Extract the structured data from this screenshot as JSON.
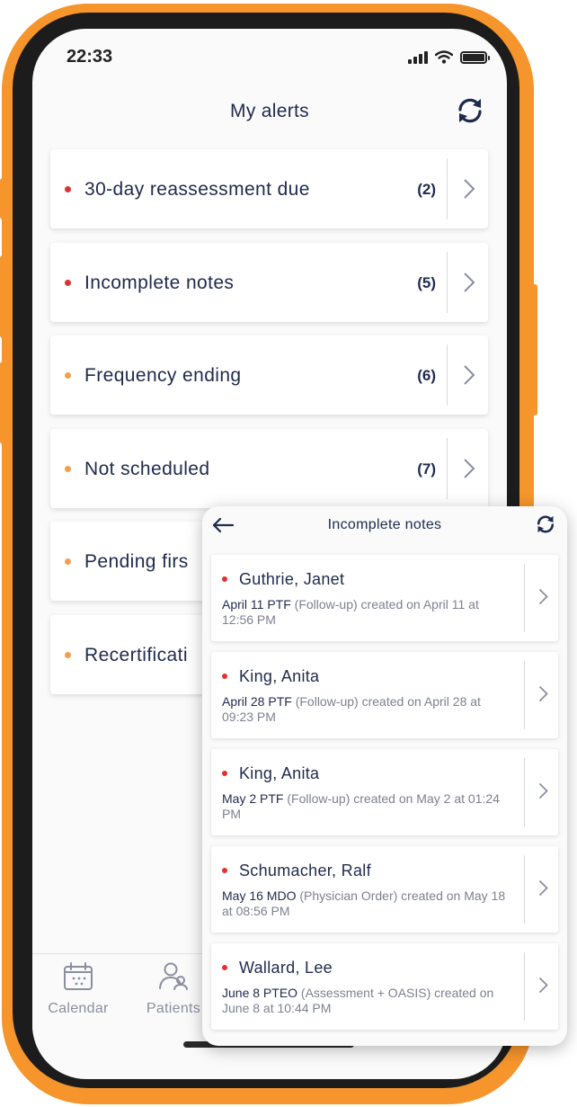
{
  "status_bar": {
    "time": "22:33"
  },
  "header": {
    "title": "My alerts",
    "refresh_icon": "refresh-icon"
  },
  "alerts": [
    {
      "label": "30-day reassessment due",
      "count": "(2)",
      "dot_color": "#e03131"
    },
    {
      "label": "Incomplete notes",
      "count": "(5)",
      "dot_color": "#e03131"
    },
    {
      "label": "Frequency ending",
      "count": "(6)",
      "dot_color": "#f0a04b"
    },
    {
      "label": "Not scheduled",
      "count": "(7)",
      "dot_color": "#f0a04b"
    },
    {
      "label": "Pending firs",
      "count": "",
      "dot_color": "#f0a04b"
    },
    {
      "label": "Recertificati",
      "count": "",
      "dot_color": "#f0a04b"
    }
  ],
  "bottom_nav": {
    "items": [
      {
        "label": "Calendar",
        "icon": "calendar-icon"
      },
      {
        "label": "Patients",
        "icon": "patients-icon"
      }
    ]
  },
  "overlay": {
    "title": "Incomplete notes",
    "notes": [
      {
        "name": "Guthrie, Janet",
        "code": "April 11 PTF",
        "detail": " (Follow-up) created on April 11 at 12:56 PM"
      },
      {
        "name": "King, Anita",
        "code": "April 28 PTF",
        "detail": " (Follow-up) created on April 28 at 09:23 PM"
      },
      {
        "name": "King, Anita",
        "code": "May 2 PTF",
        "detail": " (Follow-up) created on May 2 at 01:24 PM"
      },
      {
        "name": "Schumacher, Ralf",
        "code": "May 16 MDO",
        "detail": " (Physician Order) created on May 18 at 08:56 PM"
      },
      {
        "name": "Wallard, Lee",
        "code": "June 8 PTEO",
        "detail": " (Assessment + OASIS) created on June 8 at 10:44 PM"
      }
    ]
  },
  "colors": {
    "frame": "#f5952c",
    "text_dark": "#1f2a4d",
    "urgent_dot": "#e03131",
    "warning_dot": "#f0a04b"
  }
}
